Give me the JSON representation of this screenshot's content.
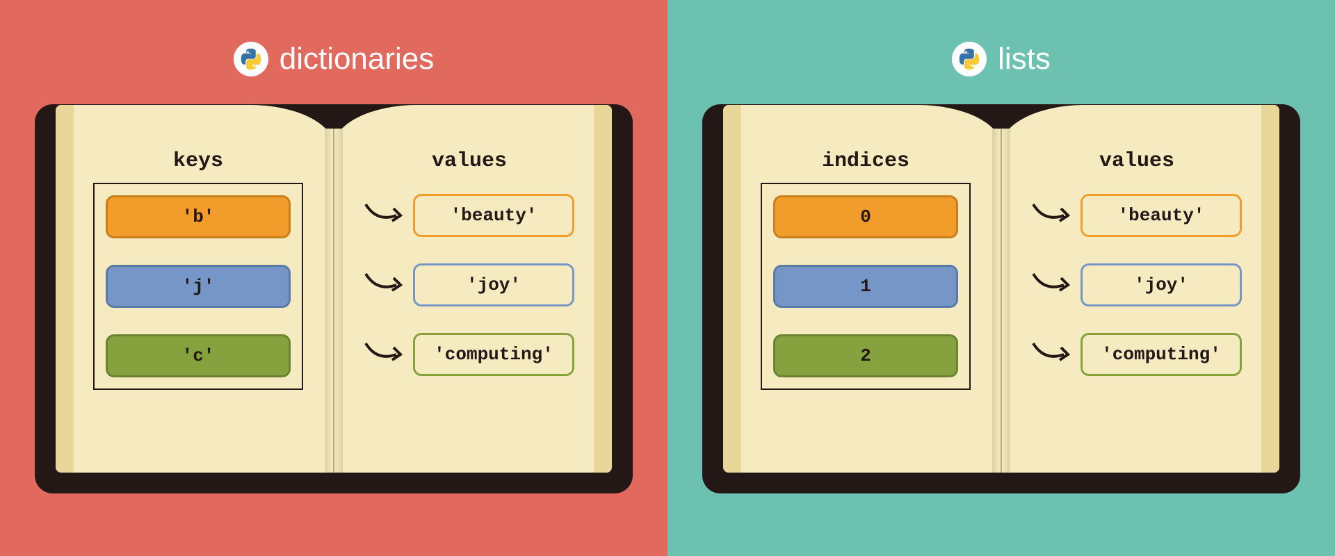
{
  "left": {
    "bg": "#e1695e",
    "title": "dictionaries",
    "left_header": "keys",
    "right_header": "values",
    "rows": [
      {
        "key": "'b'",
        "value": "'beauty'",
        "color": "orange"
      },
      {
        "key": "'j'",
        "value": "'joy'",
        "color": "blue"
      },
      {
        "key": "'c'",
        "value": "'computing'",
        "color": "green"
      }
    ]
  },
  "right": {
    "bg": "#6dc1b0",
    "title": "lists",
    "left_header": "indices",
    "right_header": "values",
    "rows": [
      {
        "key": "0",
        "value": "'beauty'",
        "color": "orange"
      },
      {
        "key": "1",
        "value": "'joy'",
        "color": "blue"
      },
      {
        "key": "2",
        "value": "'computing'",
        "color": "green"
      }
    ]
  },
  "icon": "python"
}
